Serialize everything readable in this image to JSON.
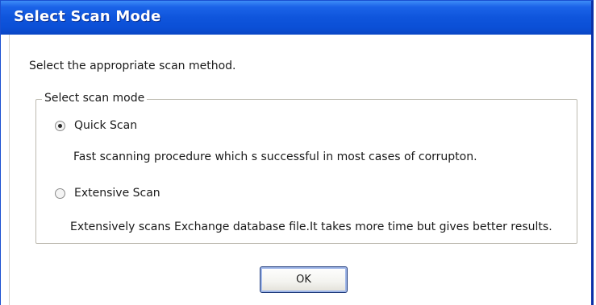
{
  "window": {
    "title": "Select Scan Mode"
  },
  "instruction": "Select the appropriate scan method.",
  "group": {
    "legend": "Select scan mode",
    "options": [
      {
        "label": "Quick Scan",
        "selected": true,
        "description": "Fast scanning procedure which s successful in most cases of corrupton."
      },
      {
        "label": "Extensive Scan",
        "selected": false,
        "description": "Extensively scans Exchange database file.It takes more time but gives better results."
      }
    ]
  },
  "buttons": {
    "ok_label": "OK"
  },
  "colors": {
    "titlebar": "#0f55dc",
    "title_text": "#ffffff",
    "button_border": "#1f3a7a"
  }
}
